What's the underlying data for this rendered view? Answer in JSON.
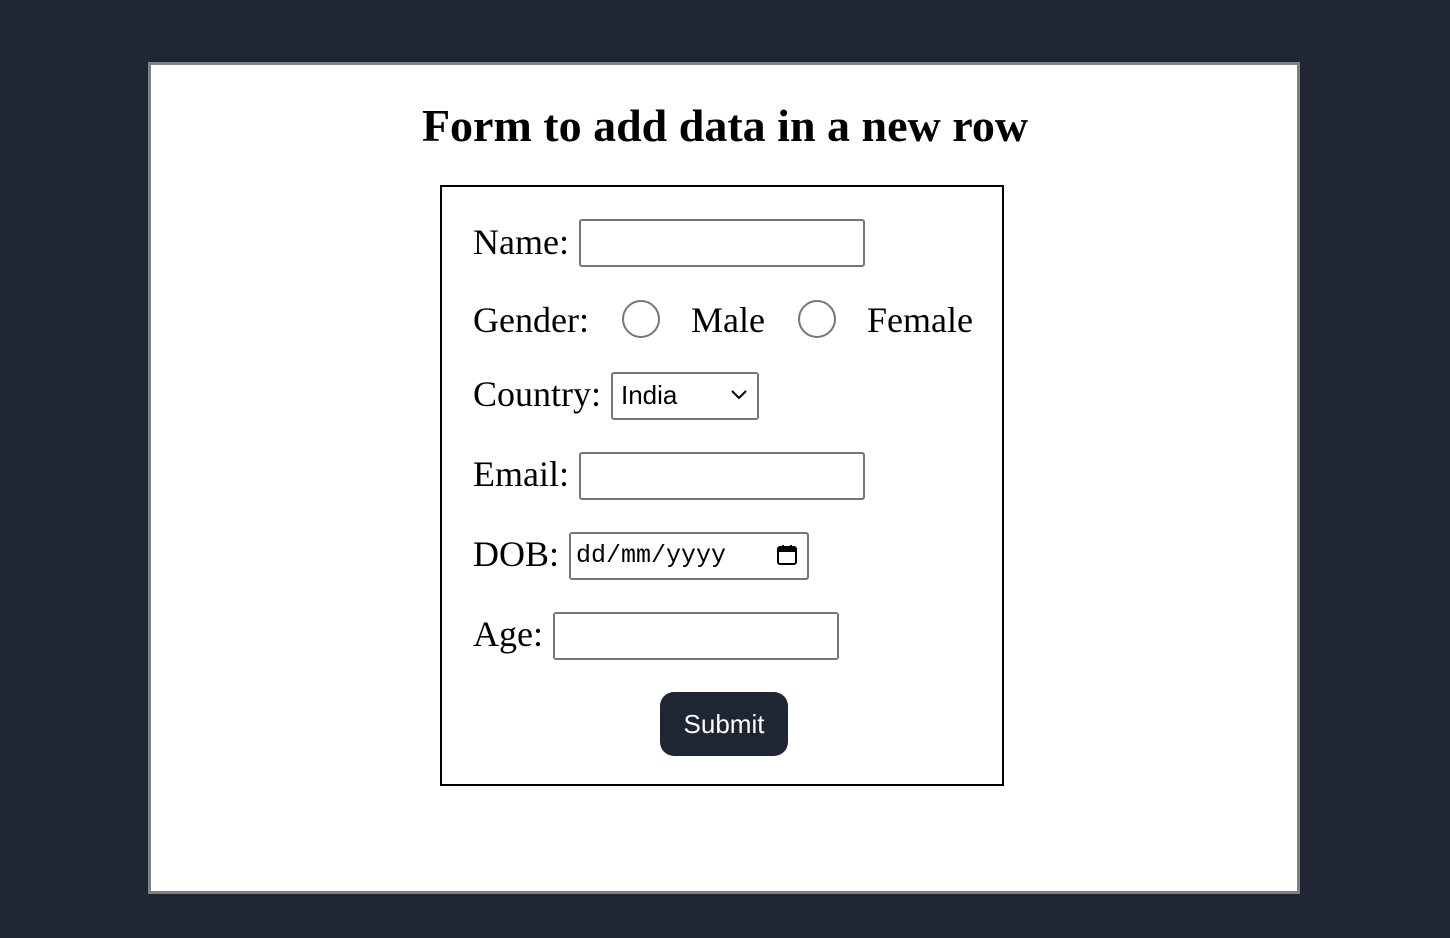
{
  "page": {
    "title": "Form to add data in a new row"
  },
  "form": {
    "name_label": "Name:",
    "gender_label": "Gender:",
    "gender_options": [
      "Male",
      "Female"
    ],
    "country_label": "Country:",
    "country_selected": "India",
    "email_label": "Email:",
    "dob_label": "DOB:",
    "dob_placeholder": "dd/mm/yyyy",
    "age_label": "Age:",
    "submit_label": "Submit"
  },
  "icons": {
    "select_arrow": "chevron-down-icon",
    "date_picker": "calendar-icon"
  },
  "colors": {
    "background": "#1f2532",
    "panel": "#ffffff",
    "button": "#1f2532"
  }
}
